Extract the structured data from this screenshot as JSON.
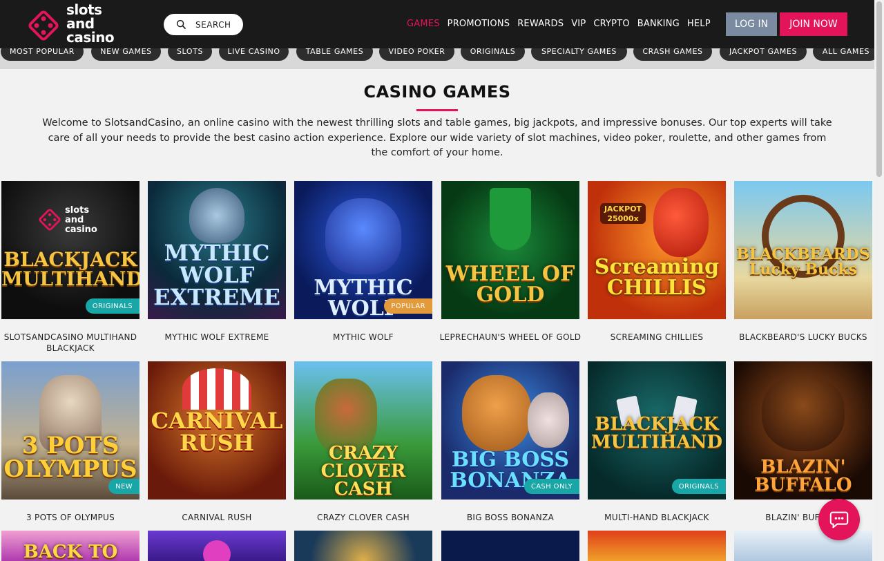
{
  "header": {
    "logo_line1": "slots",
    "logo_line2": "and",
    "logo_line3": "casino",
    "search_label": "SEARCH",
    "nav": [
      "GAMES",
      "PROMOTIONS",
      "REWARDS",
      "VIP",
      "CRYPTO",
      "BANKING",
      "HELP"
    ],
    "active_nav": "GAMES",
    "login_label": "LOG IN",
    "join_label": "JOIN NOW"
  },
  "tabs": [
    "MOST POPULAR",
    "NEW GAMES",
    "SLOTS",
    "LIVE CASINO",
    "TABLE GAMES",
    "VIDEO POKER",
    "ORIGINALS",
    "SPECIALTY GAMES",
    "CRASH GAMES",
    "JACKPOT GAMES",
    "ALL GAMES"
  ],
  "main": {
    "title": "CASINO GAMES",
    "intro": "Welcome to SlotsandCasino, an online casino with the newest thrilling slots and table games, big jackpots, and impressive bonuses. Our top experts will take care of all your needs to provide the best casino action experience. Explore our wide variety of slot machines, video poker, roulette, and other games from the comfort of your home."
  },
  "games": [
    {
      "name": "SLOTSANDCASINO MULTIHAND BLACKJACK",
      "art": "BLACKJACK MULTIHAND",
      "badge": "ORIGINALS"
    },
    {
      "name": "MYTHIC WOLF EXTREME",
      "art": "MYTHIC WOLF EXTREME",
      "badge": ""
    },
    {
      "name": "MYTHIC WOLF",
      "art": "MYTHIC WOLF",
      "badge": "POPULAR"
    },
    {
      "name": "LEPRECHAUN'S WHEEL OF GOLD",
      "art": "WHEEL OF GOLD",
      "badge": ""
    },
    {
      "name": "SCREAMING CHILLIES",
      "art": "Screaming CHILLIS",
      "badge": ""
    },
    {
      "name": "BLACKBEARD'S LUCKY BUCKS",
      "art": "BLACKBEARDS Lucky Bucks",
      "badge": ""
    },
    {
      "name": "3 POTS OF OLYMPUS",
      "art": "3 POTS OLYMPUS",
      "badge": "NEW"
    },
    {
      "name": "CARNIVAL RUSH",
      "art": "CARNIVAL RUSH",
      "badge": ""
    },
    {
      "name": "CRAZY CLOVER CASH",
      "art": "CRAZY CLOVER CASH",
      "badge": ""
    },
    {
      "name": "BIG BOSS BONANZA",
      "art": "BIG BOSS BONANZA",
      "badge": "CASH ONLY"
    },
    {
      "name": "MULTI-HAND BLACKJACK",
      "art": "BLACKJACK MULTIHAND",
      "badge": "ORIGINALS"
    },
    {
      "name": "BLAZIN' BUFFALO",
      "art": "BLAZIN' BUFFALO",
      "badge": ""
    },
    {
      "name": "",
      "art": "BACK TO",
      "badge": ""
    },
    {
      "name": "",
      "art": "",
      "badge": ""
    },
    {
      "name": "",
      "art": "",
      "badge": ""
    },
    {
      "name": "",
      "art": "",
      "badge": ""
    },
    {
      "name": "",
      "art": "",
      "badge": ""
    },
    {
      "name": "",
      "art": "",
      "badge": ""
    }
  ],
  "colors": {
    "accent": "#e4145a",
    "header_bg": "#1a1a1a",
    "login_bg": "#7a8aa0",
    "badge_teal": "#19a6a6",
    "badge_orange": "#e39a3b"
  }
}
